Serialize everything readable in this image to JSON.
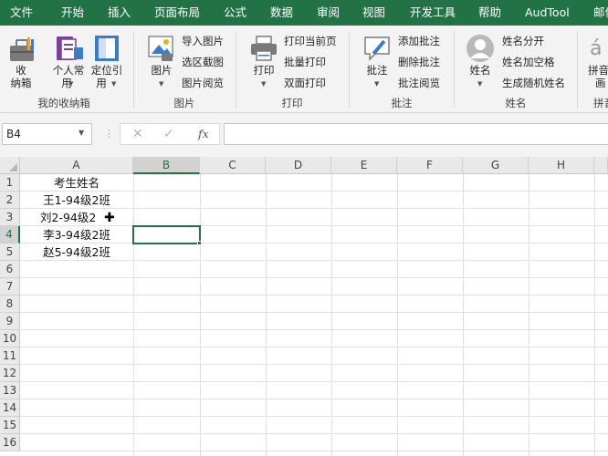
{
  "menu_tabs": [
    "文件",
    "开始",
    "插入",
    "页面布局",
    "公式",
    "数据",
    "审阅",
    "视图",
    "开发工具",
    "帮助",
    "AudTool",
    "邮件"
  ],
  "ribbon": {
    "groups": {
      "my_box": {
        "label": "我的收纳箱",
        "btn_box_l1": "收",
        "btn_box_l2": "纳箱",
        "btn_personal_l1": "个人常",
        "btn_personal_l2": "用",
        "btn_locate_l1": "定位引",
        "btn_locate_l2": "用"
      },
      "picture": {
        "label": "图片",
        "btn_picture": "图片",
        "import": "导入图片",
        "select_shot": "选区截图",
        "browse": "图片阅览"
      },
      "print": {
        "label": "打印",
        "btn_print": "打印",
        "print_current": "打印当前页",
        "batch_print": "批量打印",
        "duplex_print": "双面打印"
      },
      "comment": {
        "label": "批注",
        "btn_comment": "批注",
        "add": "添加批注",
        "delete": "删除批注",
        "browse": "批注阅览"
      },
      "name": {
        "label": "姓名",
        "btn_name": "姓名",
        "split": "姓名分开",
        "add_space": "姓名加空格",
        "random": "生成随机姓名"
      },
      "pinyin": {
        "label": "拼音",
        "btn_l1": "拼音",
        "btn_l2": "画"
      }
    }
  },
  "formula_bar": {
    "name_box": "B4",
    "cancel_icon": "✕",
    "enter_icon": "✓",
    "fx_label": "fx",
    "formula": ""
  },
  "sheet": {
    "columns": [
      "A",
      "B",
      "C",
      "D",
      "E",
      "F",
      "G",
      "H"
    ],
    "rows": [
      "1",
      "2",
      "3",
      "4",
      "5",
      "6",
      "7",
      "8",
      "9",
      "10",
      "11",
      "12",
      "13",
      "14",
      "15",
      "16"
    ],
    "selected_cell": "B4",
    "cells": {
      "A1": "考生姓名",
      "A2": "王1-94级2班",
      "A3": "刘2-94级2",
      "A4": "李3-94级2班",
      "A5": "赵5-94级2班"
    }
  },
  "colors": {
    "accent": "#217346",
    "ribbon_bg": "#f3f3f3",
    "header_bg": "#e9e9e9"
  }
}
